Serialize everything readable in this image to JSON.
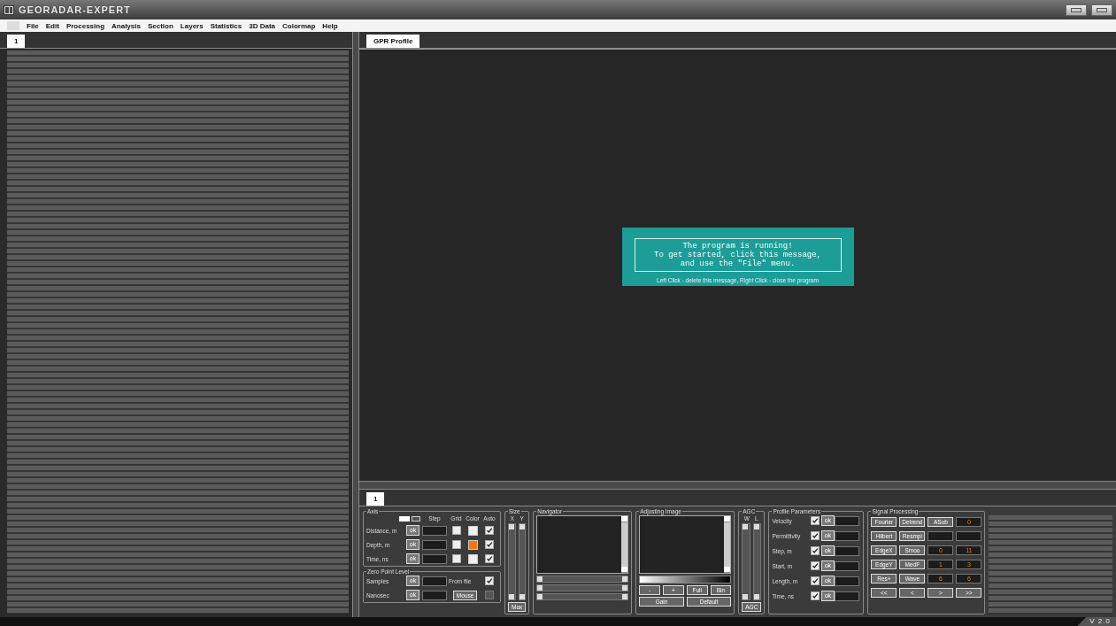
{
  "window": {
    "title": "GEORADAR-EXPERT",
    "version": "V 2.0"
  },
  "menu": [
    "File",
    "Edit",
    "Processing",
    "Analysis",
    "Section",
    "Layers",
    "Statistics",
    "3D Data",
    "Colormap",
    "Help"
  ],
  "left_panel": {
    "tabs": [
      {
        "label": "1",
        "selected": true
      }
    ]
  },
  "profile": {
    "tabs": [
      {
        "label": "GPR Profile",
        "selected": true
      }
    ],
    "message": {
      "lines": [
        "The program is running!",
        "To get started, click this message,",
        "and use the \"File\" menu."
      ],
      "hint": "Left Click - delete this message, Right Click - close the program"
    }
  },
  "bottom_tabs": [
    {
      "label": "1",
      "selected": true
    }
  ],
  "axis": {
    "title": "Axis",
    "headers": [
      "Step",
      "Grid",
      "Color",
      "Auto"
    ],
    "rows": [
      {
        "label": "Distance, m",
        "button": "ok",
        "grid": false,
        "color": "#f0f0f0",
        "auto": true
      },
      {
        "label": "Depth, m",
        "button": "ok",
        "grid": false,
        "color": "#f07800",
        "auto": true
      },
      {
        "label": "Time, ns",
        "button": "ok",
        "grid": false,
        "color": "#f0f0f0",
        "auto": true
      }
    ]
  },
  "zero_point": {
    "title": "Zero Point Level",
    "rows": [
      {
        "label": "Samples",
        "button": "ok",
        "kind": "text",
        "option": "From file",
        "checked": true,
        "disabled": false
      },
      {
        "label": "Nanosec",
        "button": "ok",
        "kind": "button",
        "option": "Mouse",
        "checked": false,
        "disabled": true
      }
    ]
  },
  "size": {
    "title": "Size",
    "columns": [
      "X",
      "Y"
    ],
    "button": "Max"
  },
  "navigator": {
    "title": "Navigator"
  },
  "adjusting_image": {
    "title": "Adjusting Image",
    "buttons": [
      "-",
      "+",
      "Full",
      "Bin",
      "Gain",
      "Default"
    ]
  },
  "agc": {
    "title": "AGC",
    "columns": [
      "W",
      "L"
    ],
    "button": "AGC"
  },
  "profile_parameters": {
    "title": "Profile Parameters",
    "rows": [
      {
        "label": "Velocity",
        "checked": true,
        "button": "ok"
      },
      {
        "label": "Permittivity",
        "checked": true,
        "button": "ok"
      },
      {
        "label": "Step, m",
        "checked": true,
        "button": "ok"
      },
      {
        "label": "Start, m",
        "checked": true,
        "button": "ok"
      },
      {
        "label": "Length, m",
        "checked": true,
        "button": "ok"
      },
      {
        "label": "Time, ns",
        "checked": true,
        "button": "ok"
      }
    ]
  },
  "signal_processing": {
    "title": "Signal Processing",
    "cells": [
      {
        "kind": "button",
        "text": "Fourier"
      },
      {
        "kind": "button",
        "text": "Detrend"
      },
      {
        "kind": "button",
        "text": "ASub"
      },
      {
        "kind": "value",
        "text": "0"
      },
      {
        "kind": "button",
        "text": "Hilbert"
      },
      {
        "kind": "button",
        "text": "Resmpl"
      },
      {
        "kind": "value"
      },
      {
        "kind": "value"
      },
      {
        "kind": "button",
        "text": "EdgeX"
      },
      {
        "kind": "button",
        "text": "Smoo"
      },
      {
        "kind": "value",
        "text": "0"
      },
      {
        "kind": "value",
        "text": "11"
      },
      {
        "kind": "button",
        "text": "EdgeY"
      },
      {
        "kind": "button",
        "text": "MedF"
      },
      {
        "kind": "value",
        "text": "1"
      },
      {
        "kind": "value",
        "text": "3"
      },
      {
        "kind": "button",
        "text": "Res+"
      },
      {
        "kind": "button",
        "text": "Wave"
      },
      {
        "kind": "value",
        "text": "6"
      },
      {
        "kind": "value",
        "text": "6"
      },
      {
        "kind": "button",
        "text": "<<"
      },
      {
        "kind": "button",
        "text": "<"
      },
      {
        "kind": "button",
        "text": ">"
      },
      {
        "kind": "button",
        "text": ">>"
      }
    ]
  }
}
